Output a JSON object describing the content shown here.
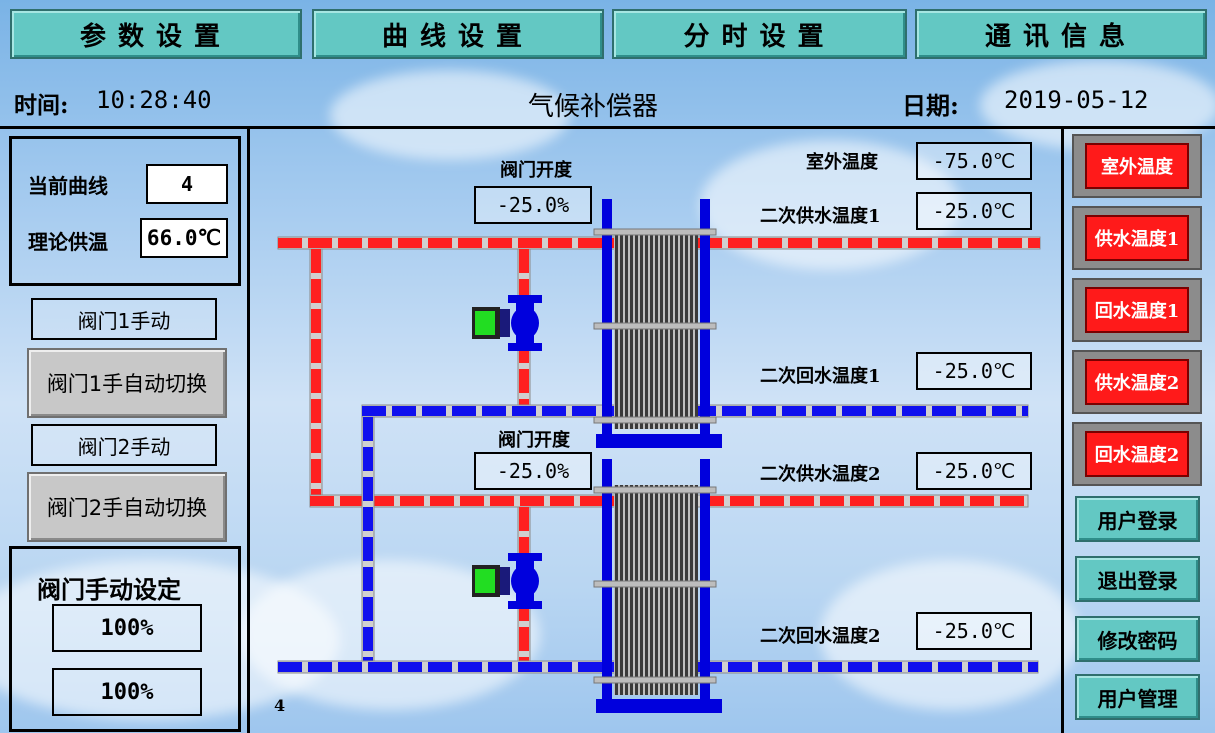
{
  "tabs": [
    "参数设置",
    "曲线设置",
    "分时设置",
    "通讯信息"
  ],
  "header": {
    "time_label": "时间:",
    "time_value": "10:28:40",
    "title": "气候补偿器",
    "date_label": "日期:",
    "date_value": "2019-05-12"
  },
  "left": {
    "curve_label": "当前曲线",
    "curve_value": "4",
    "theory_label": "理论供温",
    "theory_value": "66.0℃",
    "valve1_status": "阀门1手动",
    "valve1_switch": "阀门1手自动切换",
    "valve2_status": "阀门2手动",
    "valve2_switch": "阀门2手自动切换",
    "manual_title": "阀门手动设定",
    "manual_value1": "100%",
    "manual_value2": "100%"
  },
  "diagram": {
    "valve_open_label_1": "阀门开度",
    "valve_open_value_1": "-25.0%",
    "valve_open_label_2": "阀门开度",
    "valve_open_value_2": "-25.0%",
    "outdoor_label": "室外温度",
    "outdoor_value": "-75.0℃",
    "supply1_label": "二次供水温度1",
    "supply1_value": "-25.0℃",
    "return1_label": "二次回水温度1",
    "return1_value": "-25.0℃",
    "supply2_label": "二次供水温度2",
    "supply2_value": "-25.0℃",
    "return2_label": "二次回水温度2",
    "return2_value": "-25.0℃",
    "corner_text": "4"
  },
  "right": {
    "alarm_buttons": [
      "室外温度",
      "供水温度1",
      "回水温度1",
      "供水温度2",
      "回水温度2"
    ],
    "user_buttons": [
      "用户登录",
      "退出登录",
      "修改密码",
      "用户管理"
    ]
  },
  "colors": {
    "hot_pipe": "#ff2020",
    "cold_pipe": "#1010ee",
    "frame_blue": "#0000dd",
    "tab_teal": "#63c8c3",
    "alarm_red": "#ff1a1a",
    "valve_green": "#22dd22"
  }
}
